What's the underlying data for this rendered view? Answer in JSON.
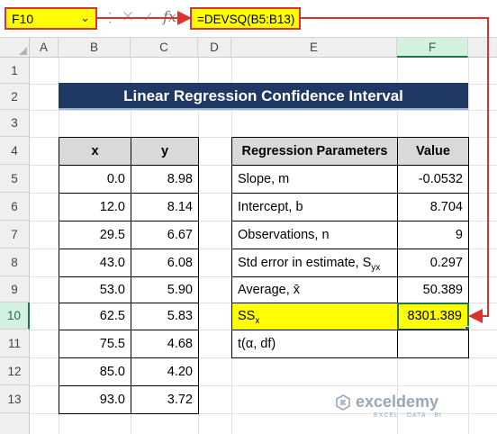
{
  "formula_bar": {
    "name_box": "F10",
    "formula": "=DEVSQ(B5:B13)",
    "fx": "fx"
  },
  "columns": [
    "A",
    "B",
    "C",
    "D",
    "E",
    "F"
  ],
  "rows": [
    "1",
    "2",
    "3",
    "4",
    "5",
    "6",
    "7",
    "8",
    "9",
    "10",
    "11",
    "12",
    "13"
  ],
  "title": "Linear Regression Confidence Interval",
  "data_table": {
    "headers": [
      "x",
      "y"
    ],
    "rows": [
      [
        "0.0",
        "8.98"
      ],
      [
        "12.0",
        "8.14"
      ],
      [
        "29.5",
        "6.67"
      ],
      [
        "43.0",
        "6.08"
      ],
      [
        "53.0",
        "5.90"
      ],
      [
        "62.5",
        "5.83"
      ],
      [
        "75.5",
        "4.68"
      ],
      [
        "85.0",
        "4.20"
      ],
      [
        "93.0",
        "3.72"
      ]
    ]
  },
  "params_table": {
    "headers": [
      "Regression Parameters",
      "Value"
    ],
    "rows": [
      {
        "label": "Slope, m",
        "value": "-0.0532"
      },
      {
        "label": "Intercept, b",
        "value": "8.704"
      },
      {
        "label": "Observations, n",
        "value": "9"
      },
      {
        "label": "Std error in estimate, S",
        "label_sub": "yx",
        "value": "0.297"
      },
      {
        "label": "Average, x̄",
        "value": "50.389"
      },
      {
        "label": "SS",
        "label_sub": "x",
        "value": "8301.389"
      },
      {
        "label": "t(α, df)",
        "value": ""
      }
    ]
  },
  "watermark": {
    "brand": "exceldemy",
    "tagline": "EXCEL · DATA · BI"
  },
  "colors": {
    "highlight": "#ffff00",
    "annotation": "#e03131",
    "title_bg": "#1f3864",
    "selection": "#217346"
  }
}
